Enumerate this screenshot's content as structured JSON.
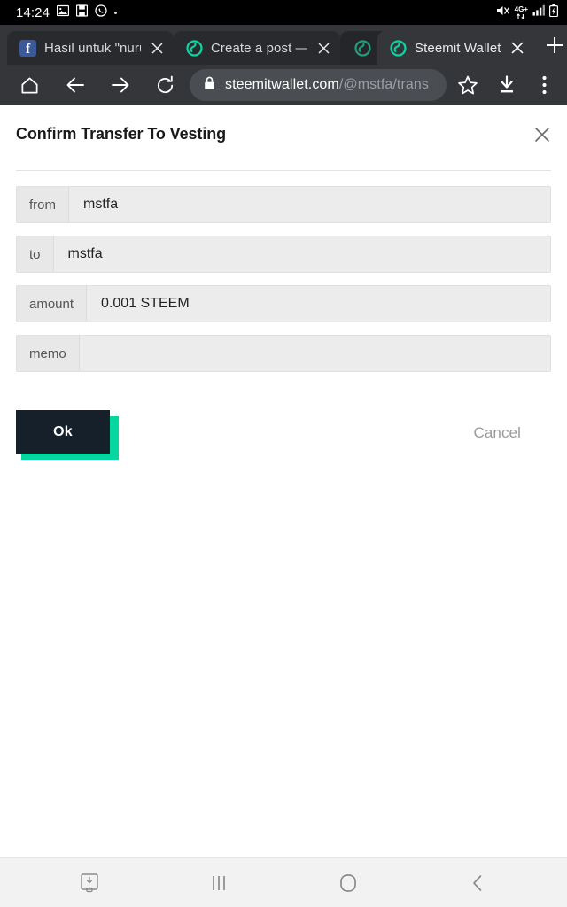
{
  "status_bar": {
    "clock": "14:24",
    "left_icons": [
      "image-icon",
      "save-screenshot-icon",
      "whatsapp-icon",
      "dot-indicator"
    ],
    "network_label": "4G+",
    "right_icons": [
      "mute-icon",
      "network-4g-plus-icon",
      "signal-bars-icon",
      "battery-icon"
    ]
  },
  "browser": {
    "tabs": [
      {
        "title": "Hasil untuk \"nuru",
        "favicon": "facebook-icon",
        "active": false,
        "hidden": false
      },
      {
        "title": "Create a post —",
        "favicon": "steemit-icon",
        "active": false,
        "hidden": false
      },
      {
        "title": "",
        "favicon": "steemit-icon",
        "active": false,
        "hidden": true
      },
      {
        "title": "Steemit Wallet",
        "favicon": "steemit-icon",
        "active": true,
        "hidden": false
      }
    ],
    "new_tab_label": "+",
    "toolbar": {
      "home_label": "Home",
      "back_label": "Back",
      "forward_label": "Forward",
      "reload_label": "Reload",
      "bookmark_label": "Bookmark",
      "download_label": "Downloads",
      "menu_label": "More options"
    },
    "omnibox": {
      "lock": "secure-lock-icon",
      "host": "steemitwallet.com",
      "path": "/@mstfa/trans",
      "full_url": "steemitwallet.com/@mstfa/trans"
    }
  },
  "dialog": {
    "title": "Confirm Transfer To Vesting",
    "close_label": "×",
    "fields": [
      {
        "label": "from",
        "value": "mstfa"
      },
      {
        "label": "to",
        "value": "mstfa"
      },
      {
        "label": "amount",
        "value": "0.001 STEEM"
      },
      {
        "label": "memo",
        "value": ""
      }
    ],
    "ok_label": "Ok",
    "cancel_label": "Cancel"
  },
  "nav_bar": {
    "buttons": [
      "screenshot-capture-icon",
      "recents-icon",
      "home-icon",
      "back-icon"
    ]
  },
  "colors": {
    "accent_teal": "#06d6a0",
    "ok_button_bg": "#16202b",
    "chrome_bg": "#35363a",
    "tab_inactive_bg": "#292a2d",
    "status_bar_bg": "#000000",
    "field_bg": "#ececec",
    "facebook_blue": "#3b5998"
  }
}
